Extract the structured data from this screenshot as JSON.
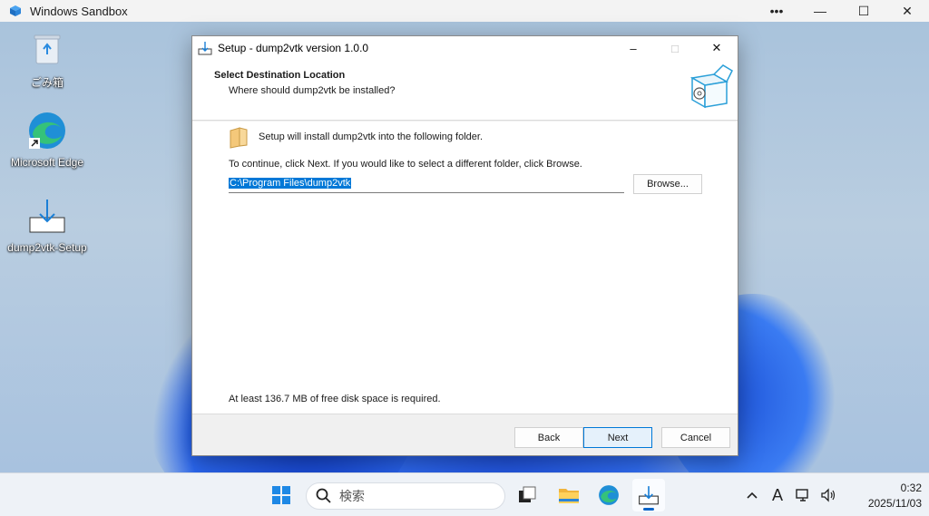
{
  "host_window": {
    "title": "Windows Sandbox",
    "controls": {
      "more": "•••",
      "minimize": "—",
      "maximize": "☐",
      "close": "✕"
    }
  },
  "desktop": {
    "icons": [
      {
        "label": "ごみ箱",
        "icon": "recycle-bin-icon"
      },
      {
        "label": "Microsoft Edge",
        "icon": "edge-icon"
      },
      {
        "label": "dump2vtk-Setup",
        "icon": "installer-icon"
      }
    ]
  },
  "dialog": {
    "title": "Setup - dump2vtk version 1.0.0",
    "controls": {
      "minimize": "–",
      "maximize": "□",
      "close": "✕"
    },
    "header": {
      "title": "Select Destination Location",
      "subtitle": "Where should dump2vtk be installed?"
    },
    "body": {
      "install_text": "Setup will install dump2vtk into the following folder.",
      "continue_text": "To continue, click Next. If you would like to select a different folder, click Browse.",
      "path_value": "C:\\Program Files\\dump2vtk",
      "browse_label": "Browse...",
      "space_text": "At least 136.7 MB of free disk space is required."
    },
    "footer": {
      "back_label": "Back",
      "next_label": "Next",
      "cancel_label": "Cancel"
    }
  },
  "taskbar": {
    "search_placeholder": "検索",
    "items": [
      "start-icon",
      "search-icon",
      "task-view-icon",
      "file-explorer-icon",
      "edge-icon",
      "installer-icon"
    ],
    "tray": {
      "chevron": "^",
      "ime": "A"
    },
    "clock": {
      "time": "0:32",
      "date": "2025/11/03"
    }
  },
  "colors": {
    "accent": "#0078d7",
    "dialog_bg": "#f0f0f0",
    "taskbar_bg": "#eef2f7"
  }
}
